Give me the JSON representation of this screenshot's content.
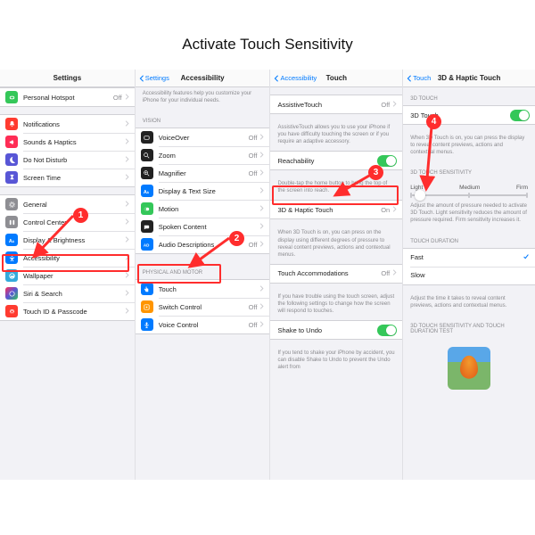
{
  "title": "Activate Touch Sensitivity",
  "callouts": [
    "1",
    "2",
    "3",
    "4"
  ],
  "panel1": {
    "nav_title": "Settings",
    "rows1": [
      {
        "icon": "link",
        "bg": "#34c759",
        "label": "Personal Hotspot",
        "value": "Off"
      }
    ],
    "rows2": [
      {
        "icon": "bell",
        "bg": "#ff3b30",
        "label": "Notifications"
      },
      {
        "icon": "speaker",
        "bg": "#ff2d55",
        "label": "Sounds & Haptics"
      },
      {
        "icon": "moon",
        "bg": "#5856d6",
        "label": "Do Not Disturb"
      },
      {
        "icon": "hourglass",
        "bg": "#5856d6",
        "label": "Screen Time"
      }
    ],
    "rows3": [
      {
        "icon": "gear",
        "bg": "#8e8e93",
        "label": "General"
      },
      {
        "icon": "sliders",
        "bg": "#8e8e93",
        "label": "Control Center"
      },
      {
        "icon": "AA",
        "bg": "#007aff",
        "label": "Display & Brightness"
      },
      {
        "icon": "person",
        "bg": "#007aff",
        "label": "Accessibility"
      },
      {
        "icon": "wallpaper",
        "bg": "#34aadc",
        "label": "Wallpaper"
      },
      {
        "icon": "siri",
        "bg": "#222",
        "label": "Siri & Search"
      },
      {
        "icon": "touch",
        "bg": "#ff3b30",
        "label": "Touch ID & Passcode"
      }
    ]
  },
  "panel2": {
    "back": "Settings",
    "nav_title": "Accessibility",
    "desc": "Accessibility features help you customize your iPhone for your individual needs.",
    "section1": "VISION",
    "rows1": [
      {
        "icon": "voiceover",
        "bg": "#222",
        "label": "VoiceOver",
        "value": "Off"
      },
      {
        "icon": "zoom",
        "bg": "#222",
        "label": "Zoom",
        "value": "Off"
      },
      {
        "icon": "magnifier",
        "bg": "#222",
        "label": "Magnifier",
        "value": "Off"
      },
      {
        "icon": "AA",
        "bg": "#007aff",
        "label": "Display & Text Size"
      },
      {
        "icon": "motion",
        "bg": "#34c759",
        "label": "Motion"
      },
      {
        "icon": "spoken",
        "bg": "#222",
        "label": "Spoken Content"
      },
      {
        "icon": "audio",
        "bg": "#007aff",
        "label": "Audio Descriptions",
        "value": "Off"
      }
    ],
    "section2": "PHYSICAL AND MOTOR",
    "rows2": [
      {
        "icon": "hand",
        "bg": "#007aff",
        "label": "Touch"
      },
      {
        "icon": "switch",
        "bg": "#ff9500",
        "label": "Switch Control",
        "value": "Off"
      },
      {
        "icon": "mic",
        "bg": "#007aff",
        "label": "Voice Control",
        "value": "Off"
      }
    ]
  },
  "panel3": {
    "back": "Accessibility",
    "nav_title": "Touch",
    "rows1": [
      {
        "label": "AssistiveTouch",
        "value": "Off"
      }
    ],
    "desc1": "AssistiveTouch allows you to use your iPhone if you have difficulty touching the screen or if you require an adaptive accessory.",
    "rows2": [
      {
        "label": "Reachability",
        "toggle": "on"
      }
    ],
    "desc2": "Double-tap the home button to bring the top of the screen into reach.",
    "rows3": [
      {
        "label": "3D & Haptic Touch",
        "value": "On"
      }
    ],
    "desc3": "When 3D Touch is on, you can press on the display using different degrees of pressure to reveal content previews, actions and contextual menus.",
    "rows4": [
      {
        "label": "Touch Accommodations",
        "value": "Off"
      }
    ],
    "desc4": "If you have trouble using the touch screen, adjust the following settings to change how the screen will respond to touches.",
    "rows5": [
      {
        "label": "Shake to Undo",
        "toggle": "on"
      }
    ],
    "desc5": "If you tend to shake your iPhone by accident, you can disable Shake to Undo to prevent the Undo alert from"
  },
  "panel4": {
    "back": "Touch",
    "nav_title": "3D & Haptic Touch",
    "section1": "3D TOUCH",
    "row1": {
      "label": "3D Touch",
      "toggle": "on"
    },
    "desc1": "When 3D Touch is on, you can press the display to reveal content previews, actions and contextual menus.",
    "section2": "3D TOUCH SENSITIVITY",
    "slider": {
      "labels": [
        "Light",
        "Medium",
        "Firm"
      ],
      "pos": 0
    },
    "desc2": "Adjust the amount of pressure needed to activate 3D Touch. Light sensitivity reduces the amount of pressure required. Firm sensitivity increases it.",
    "section3": "TOUCH DURATION",
    "rows3": [
      {
        "label": "Fast",
        "checked": true
      },
      {
        "label": "Slow",
        "checked": false
      }
    ],
    "desc3": "Adjust the time it takes to reveal content previews, actions and contextual menus.",
    "section4": "3D TOUCH SENSITIVITY AND TOUCH DURATION TEST"
  }
}
